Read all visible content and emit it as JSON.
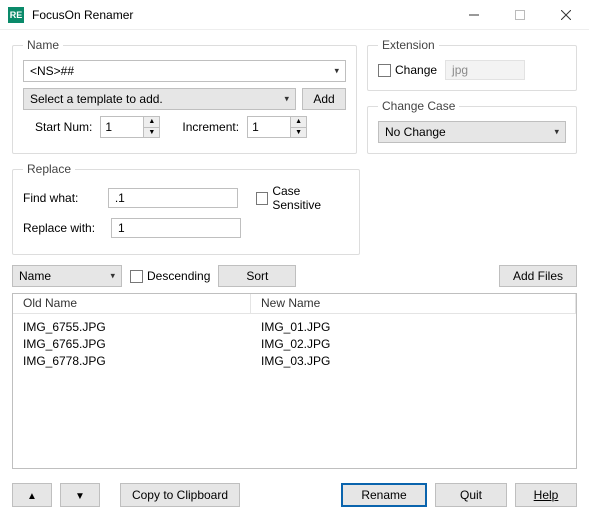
{
  "window": {
    "title": "FocusOn Renamer"
  },
  "name": {
    "legend": "Name",
    "pattern": "<NS>##",
    "template_placeholder": "Select a template to add.",
    "add_label": "Add",
    "start_label": "Start Num:",
    "start_value": "1",
    "increment_label": "Increment:",
    "increment_value": "1"
  },
  "extension": {
    "legend": "Extension",
    "change_label": "Change",
    "value": "jpg"
  },
  "change_case": {
    "legend": "Change Case",
    "value": "No Change"
  },
  "replace": {
    "legend": "Replace",
    "find_label": "Find what:",
    "find_value": ".1",
    "replace_label": "Replace with:",
    "replace_value": "1",
    "case_label": "Case Sensitive"
  },
  "sort": {
    "field": "Name",
    "descending_label": "Descending",
    "sort_label": "Sort",
    "add_files_label": "Add Files"
  },
  "grid": {
    "col_old": "Old Name",
    "col_new": "New Name",
    "rows": [
      {
        "old": "IMG_6755.JPG",
        "new": "IMG_01.JPG"
      },
      {
        "old": "IMG_6765.JPG",
        "new": "IMG_02.JPG"
      },
      {
        "old": "IMG_6778.JPG",
        "new": "IMG_03.JPG"
      }
    ]
  },
  "footer": {
    "copy_label": "Copy to Clipboard",
    "rename_label": "Rename",
    "quit_label": "Quit",
    "help_label": "Help"
  }
}
